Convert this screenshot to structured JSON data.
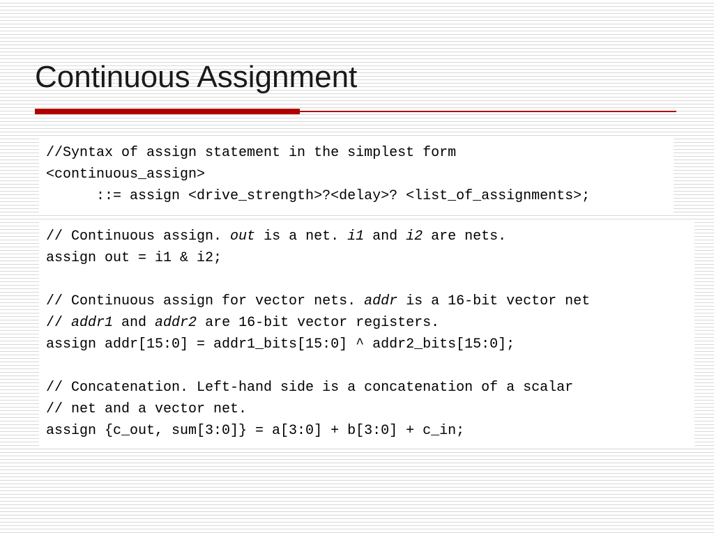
{
  "title": "Continuous Assignment",
  "syntax": {
    "line1": "//Syntax of assign statement in the simplest form",
    "line2": "<continuous_assign>",
    "line3": "      ::= assign <drive_strength>?<delay>? <list_of_assignments>;"
  },
  "ex": {
    "l1a": "// Continuous assign. ",
    "l1b": "out",
    "l1c": " is a net. ",
    "l1d": "i1",
    "l1e": " and ",
    "l1f": "i2",
    "l1g": " are nets.",
    "l2": "assign out = i1 & i2;",
    "l3a": "// Continuous assign for vector nets. ",
    "l3b": "addr",
    "l3c": " is a 16-bit vector net",
    "l4a": "// ",
    "l4b": "addr1",
    "l4c": " and ",
    "l4d": "addr2",
    "l4e": " are 16-bit vector registers.",
    "l5": "assign addr[15:0] = addr1_bits[15:0] ^ addr2_bits[15:0];",
    "l6": "// Concatenation. Left-hand side is a concatenation of a scalar",
    "l7": "// net and a vector net.",
    "l8": "assign {c_out, sum[3:0]} = a[3:0] + b[3:0] + c_in;"
  }
}
